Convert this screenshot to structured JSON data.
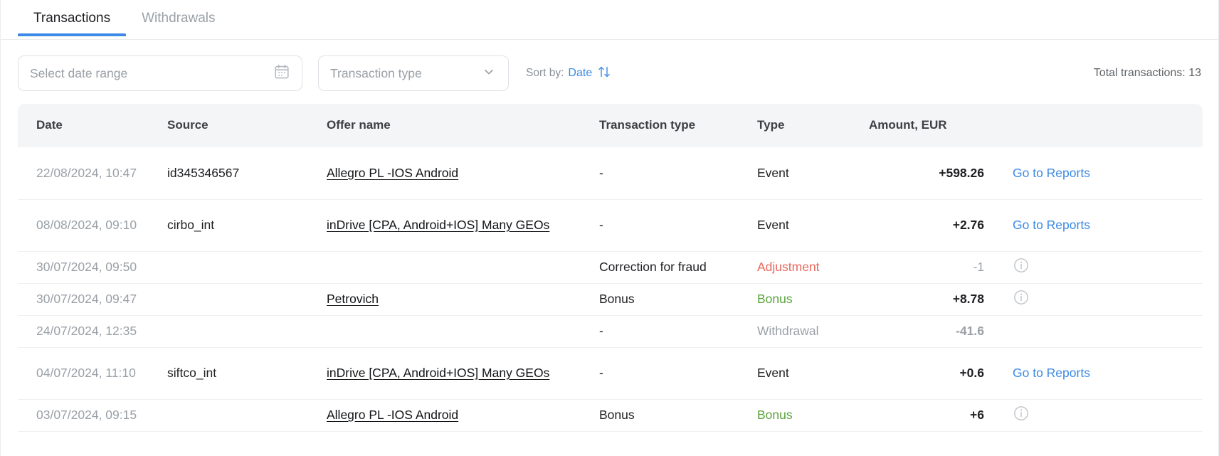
{
  "tabs": [
    {
      "label": "Transactions",
      "active": true
    },
    {
      "label": "Withdrawals",
      "active": false
    }
  ],
  "filters": {
    "date_range_placeholder": "Select date range",
    "date_range_value": "",
    "calendar_icon": "calendar-icon",
    "transaction_type_placeholder": "Transaction type",
    "transaction_type_value": "",
    "chevron_icon": "chevron-down-icon",
    "sort_label": "Sort by:",
    "sort_value": "Date",
    "sort_icon": "sort-arrows-icon",
    "total_label": "Total transactions: 13"
  },
  "colors": {
    "accent": "#3b8ae6",
    "adjustment": "#e8695e",
    "bonus": "#5aa23c",
    "muted": "#9aa0a6",
    "header_bg": "#f4f5f7"
  },
  "table": {
    "columns": [
      "Date",
      "Source",
      "Offer name",
      "Transaction type",
      "Type",
      "Amount, EUR",
      ""
    ],
    "rows": [
      {
        "date": "22/08/2024, 10:47",
        "source": "id345346567",
        "offer": "Allegro PL -IOS Android",
        "transaction_type": "-",
        "type": "Event",
        "type_style": "default",
        "amount": "+598.26",
        "amount_style": "bold",
        "action": "Go to Reports",
        "action_kind": "link",
        "height": "tall"
      },
      {
        "date": "08/08/2024, 09:10",
        "source": "cirbo_int",
        "offer": "inDrive [CPA, Android+IOS] Many GEOs",
        "transaction_type": "-",
        "type": "Event",
        "type_style": "default",
        "amount": "+2.76",
        "amount_style": "bold",
        "action": "Go to Reports",
        "action_kind": "link",
        "height": "tall"
      },
      {
        "date": "30/07/2024, 09:50",
        "source": "",
        "offer": "",
        "transaction_type": "Correction for fraud",
        "type": "Adjustment",
        "type_style": "adjustment",
        "amount": "-1",
        "amount_style": "muted",
        "action": "info",
        "action_kind": "icon",
        "height": "short"
      },
      {
        "date": "30/07/2024, 09:47",
        "source": "",
        "offer": "Petrovich",
        "transaction_type": "Bonus",
        "type": "Bonus",
        "type_style": "bonus",
        "amount": "+8.78",
        "amount_style": "bold",
        "action": "info",
        "action_kind": "icon",
        "height": "short"
      },
      {
        "date": "24/07/2024, 12:35",
        "source": "",
        "offer": "",
        "transaction_type": "-",
        "type": "Withdrawal",
        "type_style": "withdrawal",
        "amount": "-41.6",
        "amount_style": "greyb",
        "action": "",
        "action_kind": "none",
        "height": "short"
      },
      {
        "date": "04/07/2024, 11:10",
        "source": "siftco_int",
        "offer": "inDrive [CPA, Android+IOS] Many GEOs",
        "transaction_type": "-",
        "type": "Event",
        "type_style": "default",
        "amount": "+0.6",
        "amount_style": "bold",
        "action": "Go to Reports",
        "action_kind": "link",
        "height": "tall"
      },
      {
        "date": "03/07/2024, 09:15",
        "source": "",
        "offer": "Allegro PL -IOS Android",
        "transaction_type": "Bonus",
        "type": "Bonus",
        "type_style": "bonus",
        "amount": "+6",
        "amount_style": "bold",
        "action": "info",
        "action_kind": "icon",
        "height": "short"
      }
    ]
  }
}
